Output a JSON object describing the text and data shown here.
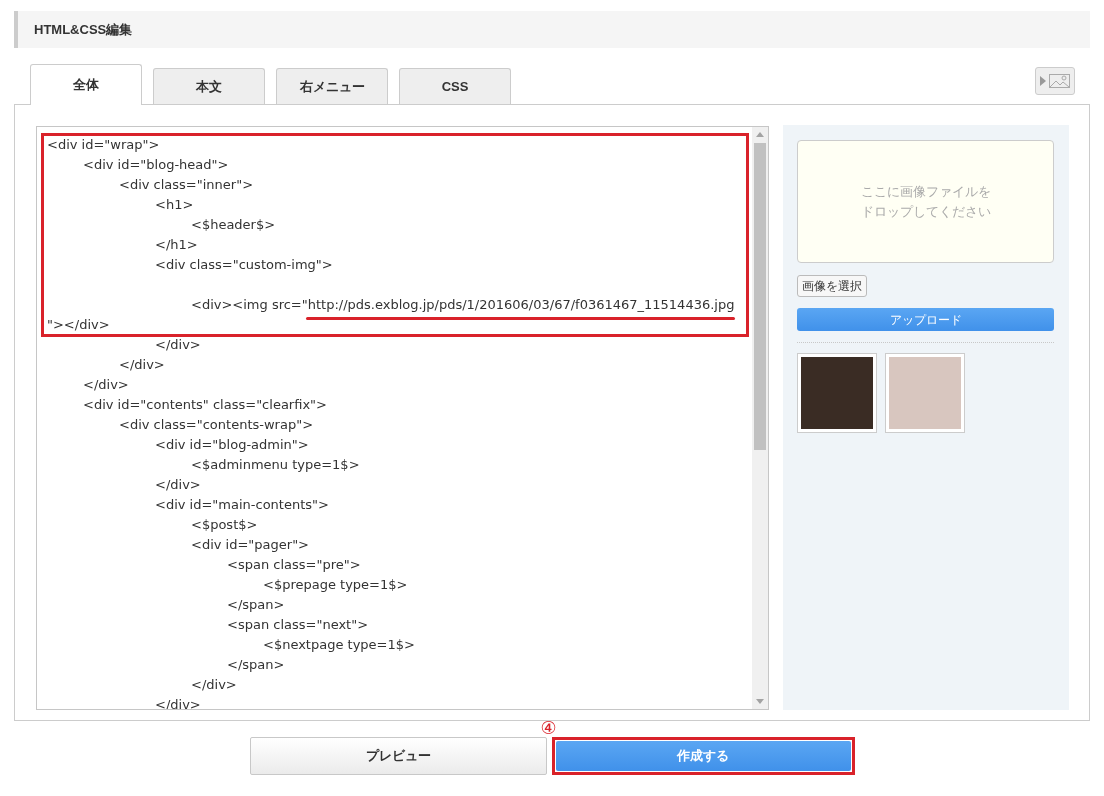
{
  "header": {
    "title": "HTML&CSS編集"
  },
  "tabs": [
    {
      "label": "全体",
      "selected": true
    },
    {
      "label": "本文",
      "selected": false
    },
    {
      "label": "右メニュー",
      "selected": false
    },
    {
      "label": "CSS",
      "selected": false
    }
  ],
  "editor": {
    "framed_lines": [
      {
        "kind": "code",
        "text": "<div id=\"wrap\">"
      },
      {
        "kind": "code",
        "text": "\t<div id=\"blog-head\">"
      },
      {
        "kind": "code",
        "text": "\t\t<div class=\"inner\">"
      },
      {
        "kind": "code",
        "text": "\t\t\t<h1>"
      },
      {
        "kind": "code",
        "text": "\t\t\t\t<$header$>"
      },
      {
        "kind": "code",
        "text": "\t\t\t</h1>"
      },
      {
        "kind": "code",
        "text": "\t\t\t<div class=\"custom-img\">"
      },
      {
        "kind": "blank"
      },
      {
        "kind": "code",
        "text": "\t\t\t\t<div><img src=\"",
        "underlined": "http://pds.exblog.jp/pds/1/201606/03/67/f0361467_11514436.jpg"
      },
      {
        "kind": "code",
        "text": "\"></div>"
      }
    ],
    "lines": [
      {
        "kind": "code",
        "text": "\t\t\t</div>"
      },
      {
        "kind": "code",
        "text": "\t\t</div>"
      },
      {
        "kind": "code",
        "text": "\t</div>"
      },
      {
        "kind": "code",
        "text": "\t<div id=\"contents\" class=\"clearfix\">"
      },
      {
        "kind": "code",
        "text": "\t\t<div class=\"contents-wrap\">"
      },
      {
        "kind": "code",
        "text": "\t\t\t<div id=\"blog-admin\">"
      },
      {
        "kind": "code",
        "text": "\t\t\t\t<$adminmenu type=1$>"
      },
      {
        "kind": "code",
        "text": "\t\t\t</div>"
      },
      {
        "kind": "code",
        "text": "\t\t\t<div id=\"main-contents\">"
      },
      {
        "kind": "code",
        "text": "\t\t\t\t<$post$>"
      },
      {
        "kind": "code",
        "text": "\t\t\t\t<div id=\"pager\">"
      },
      {
        "kind": "code",
        "text": "\t\t\t\t\t<span class=\"pre\">"
      },
      {
        "kind": "code",
        "text": "\t\t\t\t\t\t<$prepage type=1$>"
      },
      {
        "kind": "code",
        "text": "\t\t\t\t\t</span>"
      },
      {
        "kind": "code",
        "text": "\t\t\t\t\t<span class=\"next\">"
      },
      {
        "kind": "code",
        "text": "\t\t\t\t\t\t<$nextpage type=1$>"
      },
      {
        "kind": "code",
        "text": "\t\t\t\t\t</span>"
      },
      {
        "kind": "code",
        "text": "\t\t\t\t</div>"
      },
      {
        "kind": "code",
        "text": "\t\t\t</div>"
      }
    ]
  },
  "image_panel": {
    "drop_hint": "ここに画像ファイルをドロップしてください",
    "select_button": "画像を選択",
    "upload_button": "アップロード"
  },
  "buttons": [
    {
      "label": "プレビュー",
      "kind": "secondary",
      "highlighted": false
    },
    {
      "label": "作成する",
      "kind": "primary",
      "highlighted": true,
      "step": "④"
    }
  ]
}
